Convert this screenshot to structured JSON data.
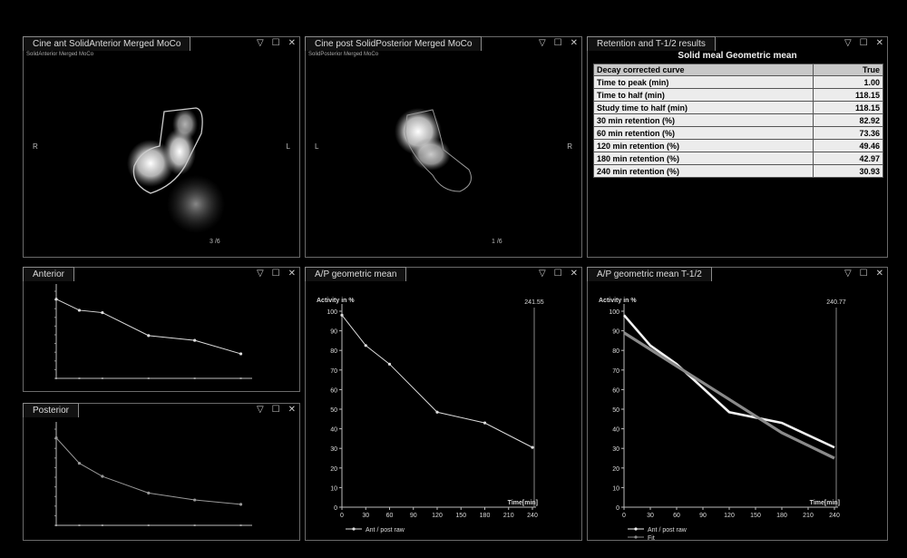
{
  "colors": {
    "background": "#000000",
    "frame": "#6a6a6a",
    "plot_line": "#dddddd",
    "fit_line": "#8a8a8a"
  },
  "panels": {
    "cine_ant": {
      "title": "Cine ant SolidAnterior Merged MoCo",
      "sublabel": "SolidAnterior Merged MoCo",
      "left_marker": "R",
      "right_marker": "L",
      "frame": "3 /6"
    },
    "cine_post": {
      "title": "Cine post SolidPosterior Merged MoCo",
      "sublabel": "SolidPosterior Merged MoCo",
      "left_marker": "L",
      "right_marker": "R",
      "frame": "1 /6"
    },
    "results": {
      "title": "Retention and T-1/2 results",
      "heading": "Solid meal Geometric mean",
      "header": {
        "label": "Decay corrected curve",
        "value": "True"
      },
      "rows": [
        {
          "label": "Time to peak (min)",
          "value": "1.00"
        },
        {
          "label": "Time to half (min)",
          "value": "118.15"
        },
        {
          "label": "Study time to half (min)",
          "value": "118.15"
        },
        {
          "label": "30 min retention (%)",
          "value": "82.92"
        },
        {
          "label": "60 min retention (%)",
          "value": "73.36"
        },
        {
          "label": "120 min retention (%)",
          "value": "49.46"
        },
        {
          "label": "180 min retention (%)",
          "value": "42.97"
        },
        {
          "label": "240 min retention (%)",
          "value": "30.93"
        }
      ]
    },
    "anterior": {
      "title": "Anterior"
    },
    "posterior": {
      "title": "Posterior"
    },
    "ap_mean": {
      "title": "A/P geometric mean"
    },
    "ap_t12": {
      "title": "A/P geometric mean T-1/2"
    }
  },
  "icons": [
    "dropdown-arrow-icon",
    "maximize-icon",
    "close-icon"
  ],
  "chart_data": [
    {
      "type": "line",
      "id": "anterior",
      "x": [
        0,
        30,
        60,
        120,
        180,
        240
      ],
      "series": [
        {
          "values": [
            100,
            86,
            83,
            54,
            48,
            31
          ]
        }
      ],
      "ylim": [
        0,
        110
      ],
      "xlim": [
        0,
        250
      ]
    },
    {
      "type": "line",
      "id": "posterior",
      "x": [
        0,
        30,
        60,
        120,
        180,
        240
      ],
      "series": [
        {
          "values": [
            100,
            71,
            56,
            37,
            29,
            24
          ]
        }
      ],
      "ylim": [
        0,
        110
      ],
      "xlim": [
        0,
        250
      ]
    },
    {
      "type": "line",
      "id": "ap_mean",
      "ylabel": "Activity in %",
      "xlabel": "Time[min]",
      "cursor_label": "241.55",
      "x": [
        0,
        30,
        60,
        120,
        180,
        240
      ],
      "xticks": [
        0,
        30,
        60,
        90,
        120,
        150,
        180,
        210,
        240
      ],
      "yticks": [
        0,
        10,
        20,
        30,
        40,
        50,
        60,
        70,
        80,
        90,
        100
      ],
      "series": [
        {
          "name": "Ant / post raw",
          "values": [
            98,
            82.5,
            73,
            48.5,
            43,
            30.5
          ]
        }
      ],
      "ylim": [
        0,
        100
      ],
      "xlim": [
        0,
        240
      ],
      "legend": "bottom-left"
    },
    {
      "type": "line",
      "id": "ap_t12",
      "ylabel": "Activity in %",
      "xlabel": "Time[min]",
      "cursor_label": "240.77",
      "x": [
        0,
        30,
        60,
        120,
        180,
        240
      ],
      "xticks": [
        0,
        30,
        60,
        90,
        120,
        150,
        180,
        210,
        240
      ],
      "yticks": [
        0,
        10,
        20,
        30,
        40,
        50,
        60,
        70,
        80,
        90,
        100
      ],
      "series": [
        {
          "name": "Ant / post raw",
          "values": [
            98,
            82.5,
            73,
            48.5,
            43,
            30.5
          ]
        },
        {
          "name": "Fit",
          "values": [
            89,
            80.5,
            72,
            55,
            38,
            25
          ]
        }
      ],
      "ylim": [
        0,
        100
      ],
      "xlim": [
        0,
        240
      ],
      "legend": "bottom-left"
    }
  ]
}
